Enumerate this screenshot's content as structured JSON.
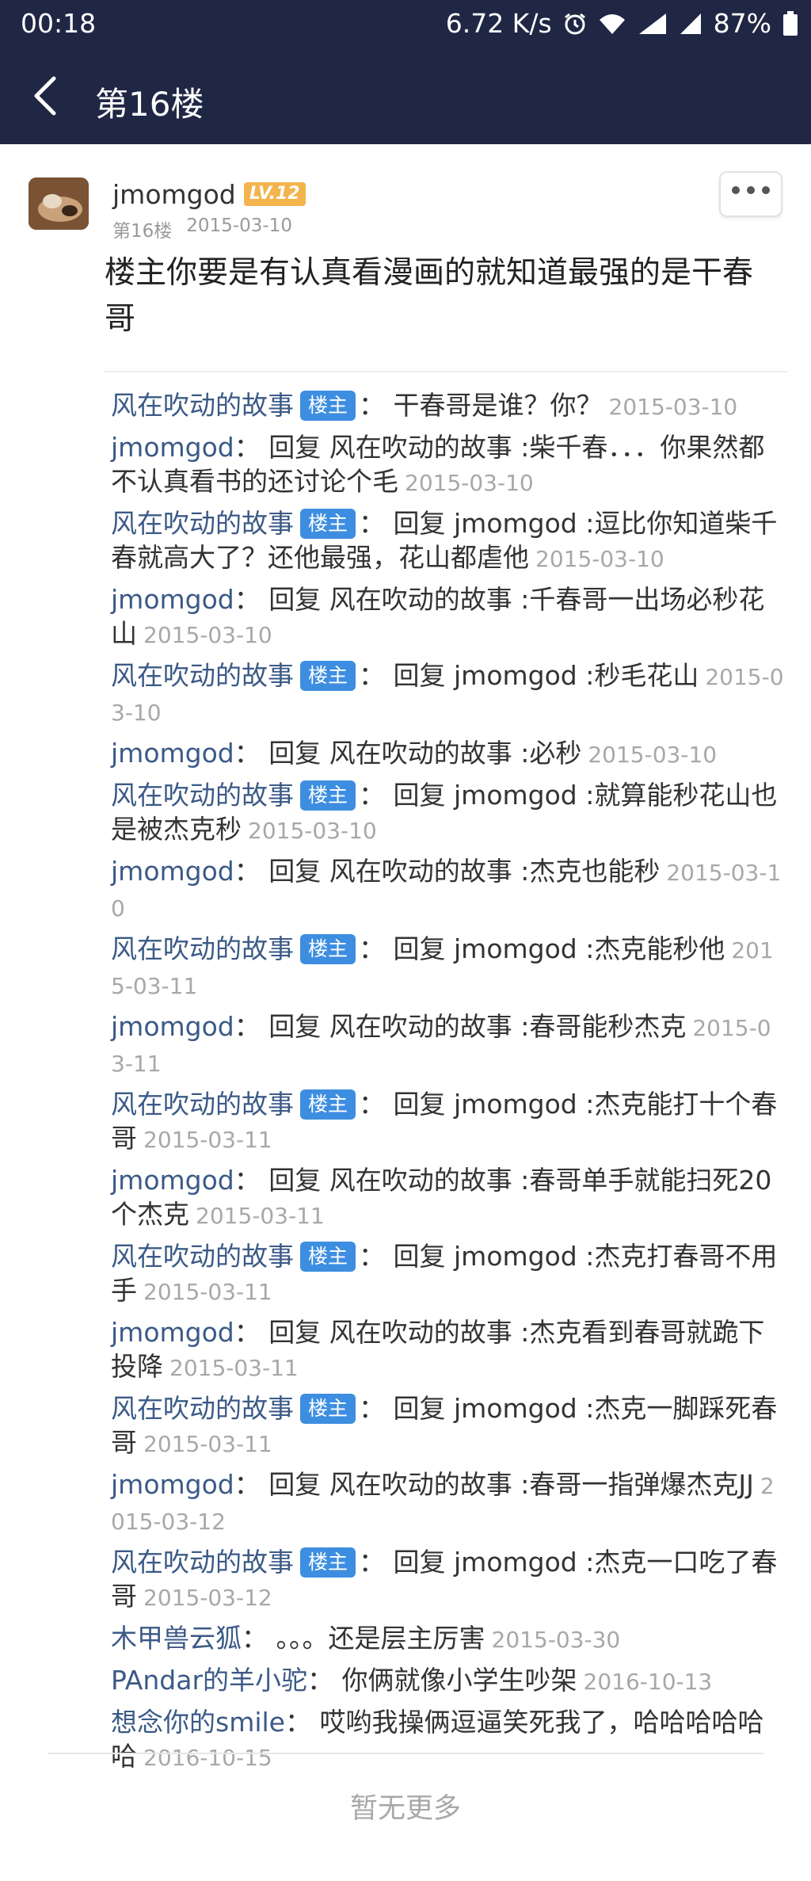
{
  "status_bar": {
    "time": "00:18",
    "speed": "6.72 K/s",
    "battery": "87%"
  },
  "nav": {
    "title": "第16楼"
  },
  "post": {
    "username": "jmomgod",
    "level": "LV.12",
    "floor": "第16楼",
    "date": "2015-03-10",
    "body": "楼主你要是有认真看漫画的就知道最强的是干春哥"
  },
  "owner_badge": "楼主",
  "replies": [
    {
      "name": "风在吹动的故事",
      "owner": true,
      "text": "干春哥是谁？你？",
      "ts": "2015-03-10"
    },
    {
      "name": "jmomgod",
      "owner": false,
      "text": "回复 风在吹动的故事 :柴千春．．．你果然都不认真看书的还讨论个毛",
      "ts": "2015-03-10"
    },
    {
      "name": "风在吹动的故事",
      "owner": true,
      "text": "回复 jmomgod :逗比你知道柴千春就高大了？还他最强，花山都虐他",
      "ts": "2015-03-10"
    },
    {
      "name": "jmomgod",
      "owner": false,
      "text": "回复 风在吹动的故事 :千春哥一出场必秒花山",
      "ts": "2015-03-10"
    },
    {
      "name": "风在吹动的故事",
      "owner": true,
      "text": "回复 jmomgod :秒毛花山",
      "ts": "2015-03-10"
    },
    {
      "name": "jmomgod",
      "owner": false,
      "text": "回复 风在吹动的故事 :必秒",
      "ts": "2015-03-10"
    },
    {
      "name": "风在吹动的故事",
      "owner": true,
      "text": "回复 jmomgod :就算能秒花山也是被杰克秒",
      "ts": "2015-03-10"
    },
    {
      "name": "jmomgod",
      "owner": false,
      "text": "回复 风在吹动的故事 :杰克也能秒",
      "ts": "2015-03-10"
    },
    {
      "name": "风在吹动的故事",
      "owner": true,
      "text": "回复 jmomgod :杰克能秒他",
      "ts": "2015-03-11"
    },
    {
      "name": "jmomgod",
      "owner": false,
      "text": "回复 风在吹动的故事 :春哥能秒杰克",
      "ts": "2015-03-11"
    },
    {
      "name": "风在吹动的故事",
      "owner": true,
      "text": "回复 jmomgod :杰克能打十个春哥",
      "ts": "2015-03-11"
    },
    {
      "name": "jmomgod",
      "owner": false,
      "text": "回复 风在吹动的故事 :春哥单手就能扫死20个杰克",
      "ts": "2015-03-11"
    },
    {
      "name": "风在吹动的故事",
      "owner": true,
      "text": "回复 jmomgod :杰克打春哥不用手",
      "ts": "2015-03-11"
    },
    {
      "name": "jmomgod",
      "owner": false,
      "text": "回复 风在吹动的故事 :杰克看到春哥就跪下投降",
      "ts": "2015-03-11"
    },
    {
      "name": "风在吹动的故事",
      "owner": true,
      "text": "回复 jmomgod :杰克一脚踩死春哥",
      "ts": "2015-03-11"
    },
    {
      "name": "jmomgod",
      "owner": false,
      "text": "回复 风在吹动的故事 :春哥一指弹爆杰克JJ",
      "ts": "2015-03-12"
    },
    {
      "name": "风在吹动的故事",
      "owner": true,
      "text": "回复 jmomgod :杰克一口吃了春哥",
      "ts": "2015-03-12"
    },
    {
      "name": "木甲兽云狐",
      "owner": false,
      "text": "。。。还是层主厉害",
      "ts": "2015-03-30"
    },
    {
      "name": "PAndar的羊小驼",
      "owner": false,
      "text": "你俩就像小学生吵架",
      "ts": "2016-10-13"
    },
    {
      "name": "想念你的smile",
      "owner": false,
      "text": "哎哟我操俩逗逼笑死我了，哈哈哈哈哈哈",
      "ts": "2016-10-15"
    }
  ],
  "footer": {
    "no_more": "暂无更多"
  },
  "colors": {
    "nav_background": "#1f2744",
    "username_blue": "#3b5a86",
    "owner_badge": "#3d8ee0",
    "level_badge": "#f3b34d",
    "timestamp_gray": "#a8a8a8"
  }
}
